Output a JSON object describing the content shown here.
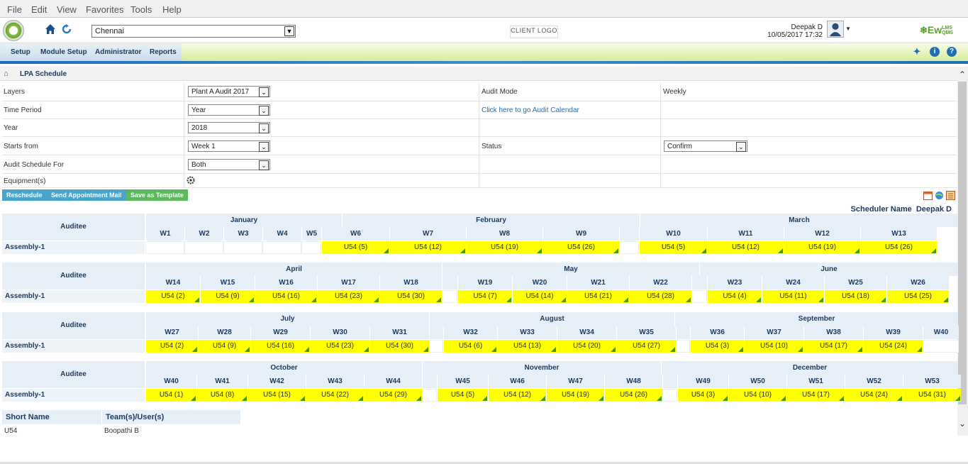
{
  "menu": [
    "File",
    "Edit",
    "View",
    "Favorites",
    "Tools",
    "Help"
  ],
  "header": {
    "location": "Chennai",
    "client_logo": "CLIENT LOGO",
    "user_name": "Deepak D",
    "datetime": "10/05/2017 17:32",
    "brand": "Ew",
    "brand_sup": "LMS QMS"
  },
  "nav": [
    "Setup",
    "Module Setup",
    "Administrator",
    "Reports"
  ],
  "breadcrumb": {
    "title": "LPA Schedule"
  },
  "form": {
    "layers_label": "Layers",
    "layers_value": "Plant A Audit 2017",
    "time_period_label": "Time Period",
    "time_period_value": "Year",
    "year_label": "Year",
    "year_value": "2018",
    "starts_from_label": "Starts from",
    "starts_from_value": "Week 1",
    "audit_schedule_for_label": "Audit Schedule For",
    "audit_schedule_for_value": "Both",
    "equipment_label": "Equipment(s)",
    "audit_mode_label": "Audit Mode",
    "audit_mode_value": "Weekly",
    "calendar_link": "Click here to go Audit Calendar",
    "status_label": "Status",
    "status_value": "Confirm"
  },
  "buttons": {
    "reschedule": "Reschedule",
    "send_mail": "Send Appointment Mail",
    "save_template": "Save as Template"
  },
  "scheduler": {
    "label": "Scheduler Name",
    "name": "Deepak D"
  },
  "auditee_label": "Auditee",
  "row_label": "Assembly-1",
  "blocks": [
    {
      "months": [
        {
          "name": "January",
          "w": 277
        },
        {
          "name": "February",
          "w": 420
        },
        {
          "name": "March",
          "w": 449
        }
      ],
      "weeks": [
        {
          "w": "W1",
          "cw": 55,
          "v": ""
        },
        {
          "w": "W2",
          "cw": 55,
          "v": ""
        },
        {
          "w": "W3",
          "cw": 55,
          "v": ""
        },
        {
          "w": "W4",
          "cw": 55,
          "v": ""
        },
        {
          "w": "W5",
          "cw": 28,
          "v": ""
        },
        {
          "w": "W6",
          "cw": 96,
          "v": "U54 (5)"
        },
        {
          "w": "W7",
          "cw": 108,
          "v": "U54 (12)"
        },
        {
          "w": "W8",
          "cw": 108,
          "v": "U54 (19)"
        },
        {
          "w": "W9",
          "cw": 108,
          "v": "U54 (26)"
        },
        {
          "w": "",
          "cw": 28,
          "v": ""
        },
        {
          "w": "W10",
          "cw": 96,
          "v": "U54 (5)"
        },
        {
          "w": "W11",
          "cw": 108,
          "v": "U54 (12)"
        },
        {
          "w": "W12",
          "cw": 108,
          "v": "U54 (19)"
        },
        {
          "w": "W13",
          "cw": 108,
          "v": "U54 (26)"
        }
      ]
    },
    {
      "months": [
        {
          "name": "April",
          "w": 418
        },
        {
          "name": "May",
          "w": 363
        },
        {
          "name": "June",
          "w": 365
        }
      ],
      "weeks": [
        {
          "w": "W14",
          "cw": 77,
          "v": "U54 (2)"
        },
        {
          "w": "W15",
          "cw": 77,
          "v": "U54 (9)"
        },
        {
          "w": "W16",
          "cw": 88,
          "v": "U54 (16)"
        },
        {
          "w": "W17",
          "cw": 88,
          "v": "U54 (23)"
        },
        {
          "w": "W18",
          "cw": 88,
          "v": "U54 (30)"
        },
        {
          "w": "",
          "cw": 22,
          "v": ""
        },
        {
          "w": "W19",
          "cw": 77,
          "v": "U54 (7)"
        },
        {
          "w": "W20",
          "cw": 77,
          "v": "U54 (14)"
        },
        {
          "w": "W21",
          "cw": 88,
          "v": "U54 (21)"
        },
        {
          "w": "W22",
          "cw": 88,
          "v": "U54 (28)"
        },
        {
          "w": "",
          "cw": 22,
          "v": ""
        },
        {
          "w": "W23",
          "cw": 77,
          "v": "U54 (4)"
        },
        {
          "w": "W24",
          "cw": 88,
          "v": "U54 (11)"
        },
        {
          "w": "W25",
          "cw": 88,
          "v": "U54 (18)"
        },
        {
          "w": "W26",
          "cw": 88,
          "v": "U54 (25)"
        }
      ]
    },
    {
      "months": [
        {
          "name": "July",
          "w": 400
        },
        {
          "name": "August",
          "w": 346
        },
        {
          "name": "September",
          "w": 400
        }
      ],
      "weeks": [
        {
          "w": "W27",
          "cw": 74,
          "v": "U54 (2)"
        },
        {
          "w": "W28",
          "cw": 74,
          "v": "U54 (9)"
        },
        {
          "w": "W29",
          "cw": 84,
          "v": "U54 (16)"
        },
        {
          "w": "W30",
          "cw": 84,
          "v": "U54 (23)"
        },
        {
          "w": "W31",
          "cw": 84,
          "v": "U54 (30)"
        },
        {
          "w": "",
          "cw": 20,
          "v": ""
        },
        {
          "w": "W32",
          "cw": 76,
          "v": "U54 (6)"
        },
        {
          "w": "W33",
          "cw": 84,
          "v": "U54 (13)"
        },
        {
          "w": "W34",
          "cw": 84,
          "v": "U54 (20)"
        },
        {
          "w": "W35",
          "cw": 84,
          "v": "U54 (27)"
        },
        {
          "w": "",
          "cw": 20,
          "v": ""
        },
        {
          "w": "W36",
          "cw": 76,
          "v": "U54 (3)"
        },
        {
          "w": "W37",
          "cw": 84,
          "v": "U54 (10)"
        },
        {
          "w": "W38",
          "cw": 84,
          "v": "U54 (17)"
        },
        {
          "w": "W39",
          "cw": 84,
          "v": "U54 (24)"
        },
        {
          "w": "W40",
          "cw": 51,
          "v": ""
        }
      ]
    },
    {
      "months": [
        {
          "name": "October",
          "w": 390
        },
        {
          "name": "November",
          "w": 337
        },
        {
          "name": "December",
          "w": 419
        }
      ],
      "weeks": [
        {
          "w": "W40",
          "cw": 72,
          "v": "U54 (1)"
        },
        {
          "w": "W41",
          "cw": 72,
          "v": "U54 (8)"
        },
        {
          "w": "W42",
          "cw": 82,
          "v": "U54 (15)"
        },
        {
          "w": "W43",
          "cw": 82,
          "v": "U54 (22)"
        },
        {
          "w": "W44",
          "cw": 82,
          "v": "U54 (29)"
        },
        {
          "w": "",
          "cw": 21,
          "v": ""
        },
        {
          "w": "W45",
          "cw": 72,
          "v": "U54 (5)"
        },
        {
          "w": "W46",
          "cw": 82,
          "v": "U54 (12)"
        },
        {
          "w": "W47",
          "cw": 82,
          "v": "U54 (19)"
        },
        {
          "w": "W48",
          "cw": 82,
          "v": "U54 (26)"
        },
        {
          "w": "",
          "cw": 21,
          "v": ""
        },
        {
          "w": "W49",
          "cw": 72,
          "v": "U54 (3)"
        },
        {
          "w": "W50",
          "cw": 82,
          "v": "U54 (10)"
        },
        {
          "w": "W51",
          "cw": 82,
          "v": "U54 (17)"
        },
        {
          "w": "W52",
          "cw": 82,
          "v": "U54 (24)"
        },
        {
          "w": "W53",
          "cw": 82,
          "v": "U54 (31)"
        }
      ]
    }
  ],
  "legend": {
    "col1": "Short Name",
    "col2": "Team(s)/User(s)",
    "rows": [
      {
        "short": "U54",
        "user": "Boopathi B"
      }
    ]
  },
  "colors": {
    "scheduled": "#ffff00",
    "flag": "#3c9a1c",
    "header_bg": "#e6eff7",
    "accent": "#1d6fb8"
  }
}
